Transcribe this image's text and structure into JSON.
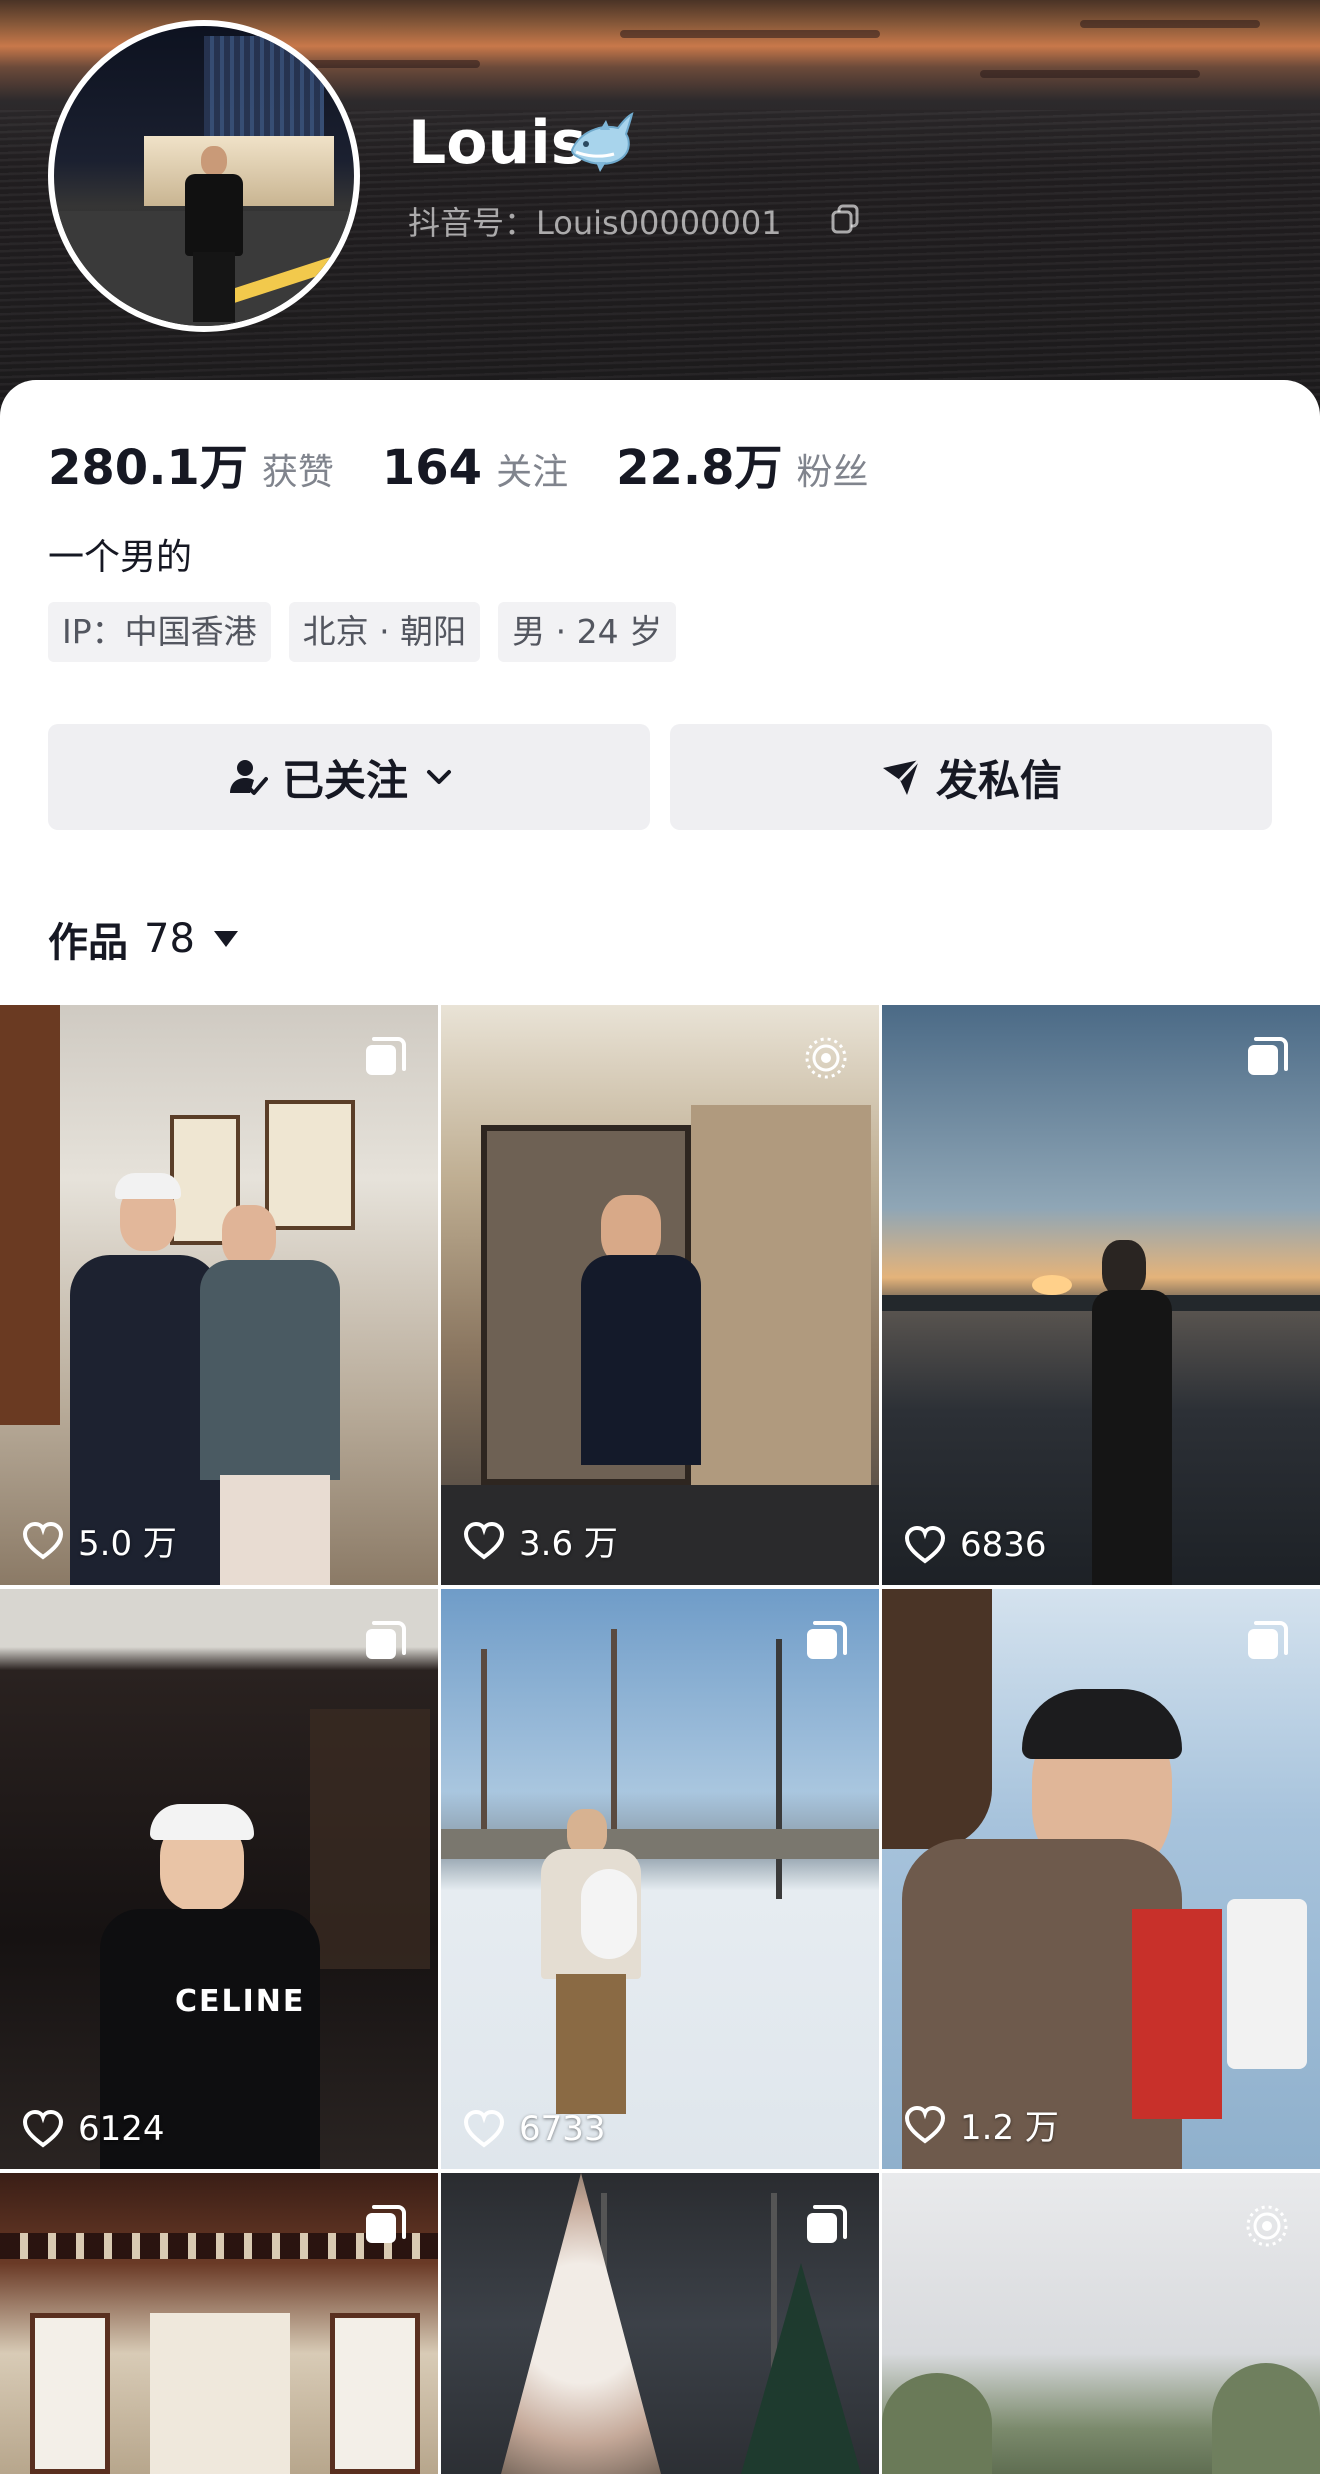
{
  "profile": {
    "username": "Louis",
    "username_icon": "fish-icon",
    "douyin_id": "抖音号：Louis00000001",
    "stats": [
      {
        "value": "280.1万",
        "label": "获赞"
      },
      {
        "value": "164",
        "label": "关注"
      },
      {
        "value": "22.8万",
        "label": "粉丝"
      }
    ],
    "bio": "一个男的",
    "tags": [
      "IP：中国香港",
      "北京 · 朝阳",
      "男 · 24 岁"
    ]
  },
  "actions": {
    "follow_label": "已关注",
    "message_label": "发私信"
  },
  "works": {
    "tab_label": "作品",
    "count": "78"
  },
  "videos": [
    {
      "likes": "5.0 万",
      "badge": "multi-photo-icon"
    },
    {
      "likes": "3.6 万",
      "badge": "live-photo-icon"
    },
    {
      "likes": "6836",
      "badge": "multi-photo-icon"
    },
    {
      "likes": "6124",
      "badge": "multi-photo-icon"
    },
    {
      "likes": "6733",
      "badge": "multi-photo-icon"
    },
    {
      "likes": "1.2 万",
      "badge": "multi-photo-icon"
    },
    {
      "likes": "",
      "badge": "multi-photo-icon"
    },
    {
      "likes": "",
      "badge": "multi-photo-icon"
    },
    {
      "likes": "",
      "badge": "live-photo-icon"
    }
  ],
  "colors": {
    "text_primary": "#161823",
    "text_secondary": "#80848d",
    "button_bg": "#efeff2",
    "tag_bg": "#f2f2f4"
  }
}
